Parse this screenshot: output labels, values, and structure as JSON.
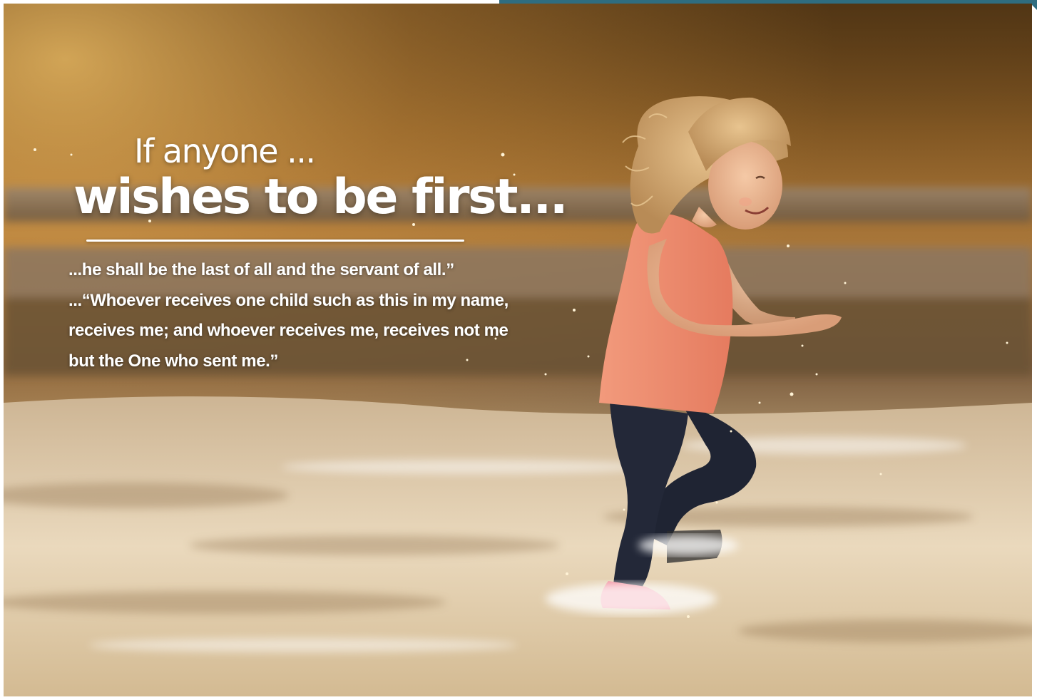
{
  "headline": {
    "line1": "If anyone ...",
    "line2": "wishes to be first..."
  },
  "quote": {
    "lines": [
      "...he shall be the last of all and the servant of all.”",
      "...“Whoever receives one child such as this in my name,",
      "receives me; and whoever receives me, receives not me",
      "but the One who sent me.”"
    ]
  },
  "colors": {
    "text": "#ffffff",
    "sky_warm": "#c88a3c",
    "accent_bar": "#2f6d80",
    "shirt": "#f08a6e",
    "leggings": "#1d2230"
  }
}
